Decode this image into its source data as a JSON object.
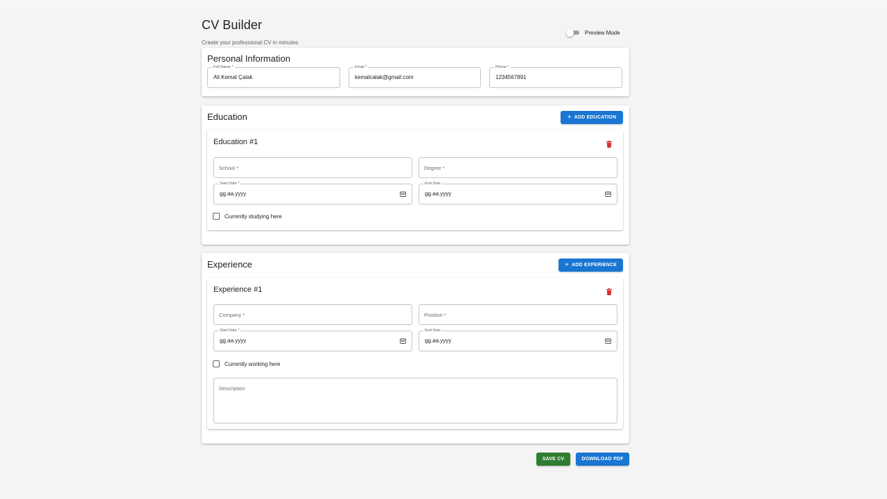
{
  "header": {
    "title": "CV Builder",
    "subtitle": "Create your professional CV in minutes",
    "preview_label": "Preview Mode"
  },
  "personal": {
    "title": "Personal Information",
    "full_name": {
      "label": "Full Name *",
      "value": "Ali Kemal Çalak"
    },
    "email": {
      "label": "Email *",
      "value": "kemalcalak@gmail.com"
    },
    "phone": {
      "label": "Phone *",
      "value": "1234567891"
    }
  },
  "education": {
    "title": "Education",
    "add_button": "ADD EDUCATION",
    "entry_title": "Education #1",
    "school_placeholder": "School *",
    "degree_placeholder": "Degree *",
    "start_date": {
      "label": "Start Date *",
      "value": "gg.aa.yyyy"
    },
    "end_date": {
      "label": "End Date",
      "value": "gg.aa.yyyy"
    },
    "current_label": "Currently studying here"
  },
  "experience": {
    "title": "Experience",
    "add_button": "ADD EXPERIENCE",
    "entry_title": "Experience #1",
    "company_placeholder": "Company *",
    "position_placeholder": "Position *",
    "start_date": {
      "label": "Start Date *",
      "value": "gg.aa.yyyy"
    },
    "end_date": {
      "label": "End Date",
      "value": "gg.aa.yyyy"
    },
    "current_label": "Currently working here",
    "description_placeholder": "Description"
  },
  "actions": {
    "save": "SAVE CV",
    "download": "DOWNLOAD PDF"
  },
  "colors": {
    "primary": "#1976d2",
    "success": "#2e7d32",
    "danger": "#d32f2f",
    "background": "#f4f4f4"
  }
}
